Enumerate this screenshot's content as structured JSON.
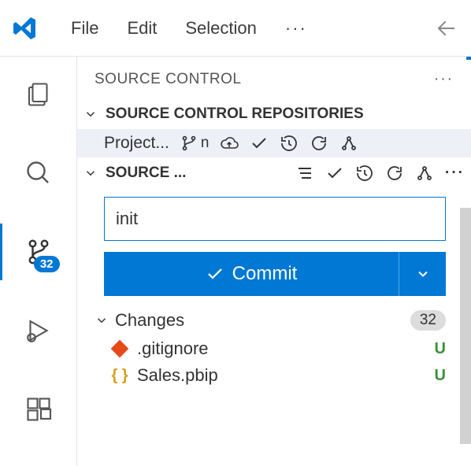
{
  "menubar": {
    "items": [
      "File",
      "Edit",
      "Selection"
    ],
    "more": "···"
  },
  "activity": {
    "scm_badge": "32"
  },
  "panel": {
    "title": "SOURCE CONTROL",
    "more": "···",
    "repos_section": "SOURCE CONTROL REPOSITORIES",
    "repo_name": "Project...",
    "repo_branch_hint": "n",
    "source_section": "SOURCE ...",
    "commit_input_value": "init",
    "commit_button": "Commit",
    "changes_label": "Changes",
    "changes_count": "32",
    "files": [
      {
        "name": ".gitignore",
        "status": "U",
        "icon": "gitignore"
      },
      {
        "name": "Sales.pbip",
        "status": "U",
        "icon": "braces"
      }
    ]
  }
}
